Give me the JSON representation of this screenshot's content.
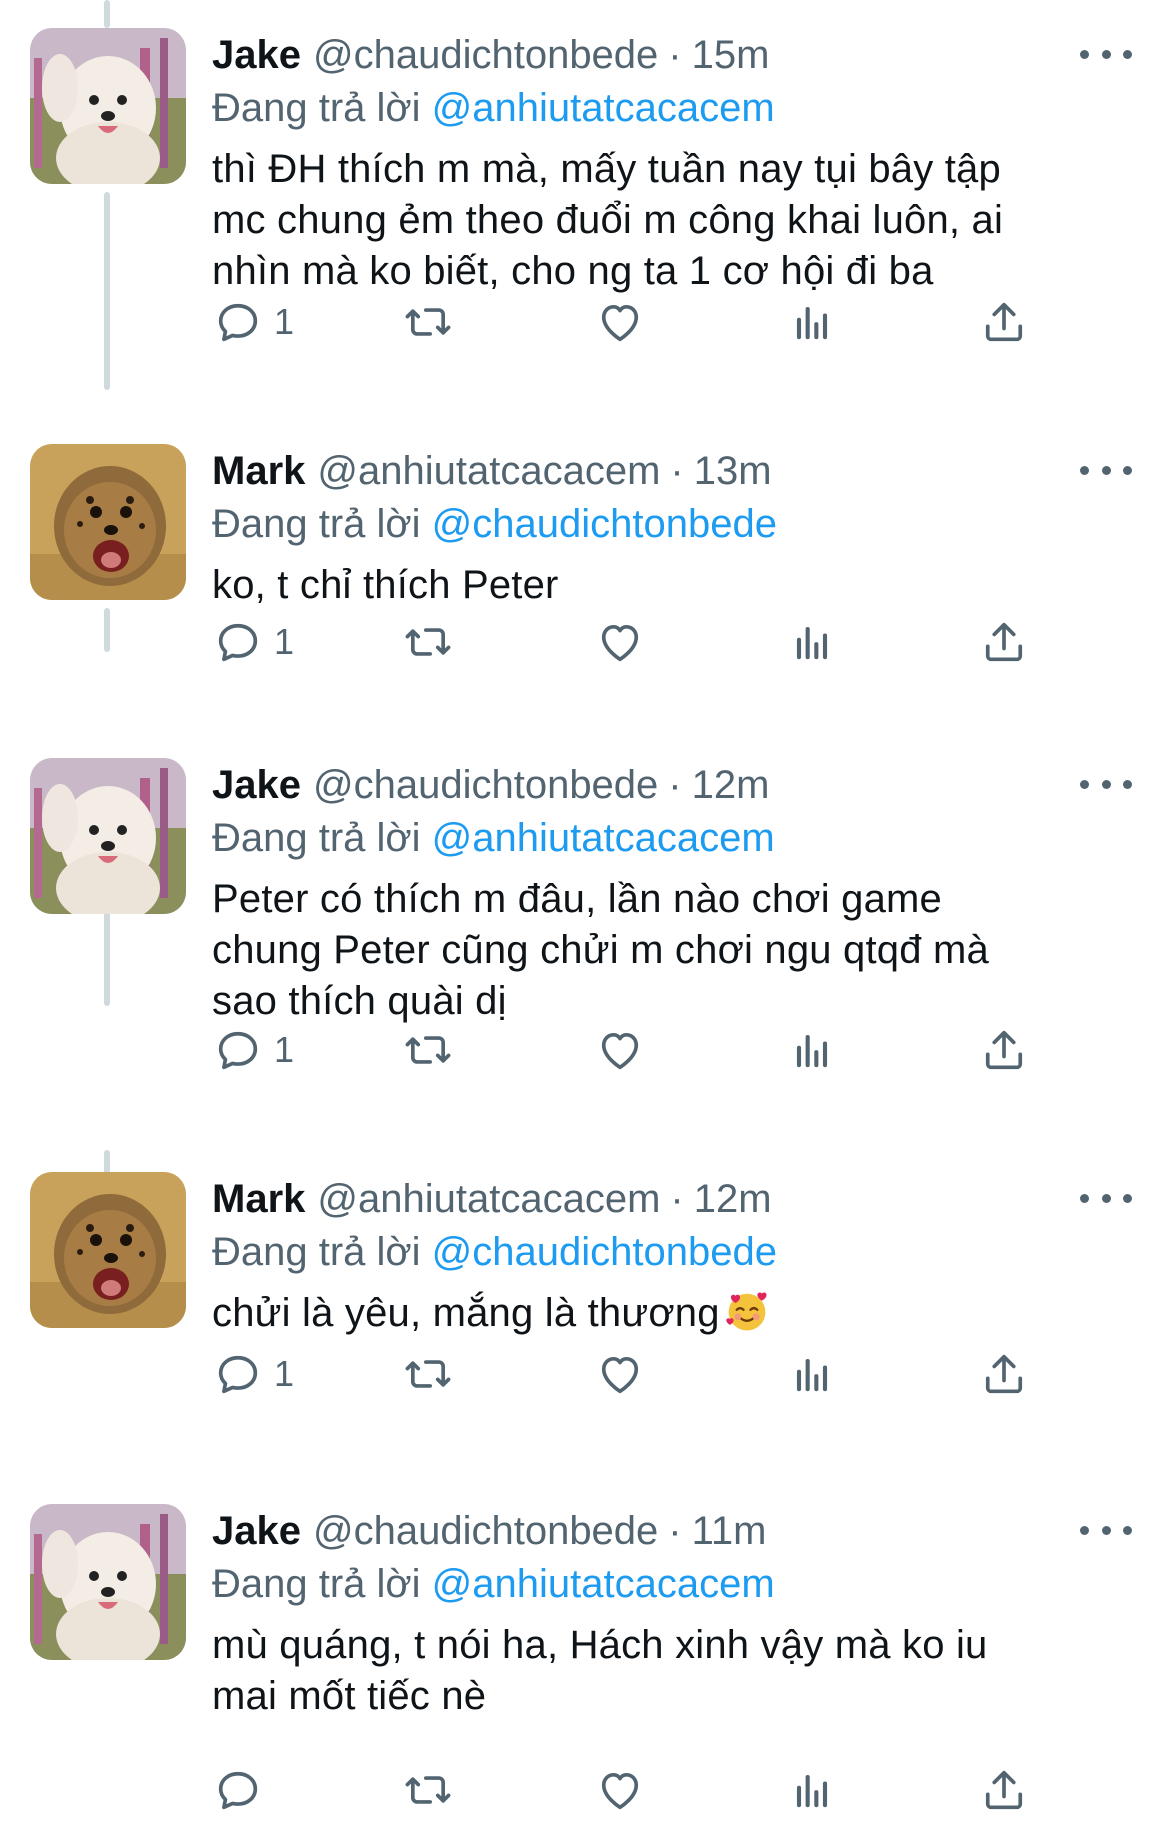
{
  "replying_prefix": "Đang trả lời",
  "colors": {
    "accent": "#1d9bf0",
    "muted": "#536471",
    "text": "#0f1419"
  },
  "icons": {
    "reply": "reply-icon",
    "retweet": "retweet-icon",
    "like": "heart-icon",
    "views": "views-icon",
    "share": "share-icon",
    "more": "more-icon"
  },
  "tweets": [
    {
      "name": "Jake",
      "handle": "@chaudichtonbede",
      "sep": "·",
      "time": "15m",
      "mention": "@anhiutatcacacem",
      "lines": [
        "thì ĐH thích m mà, mấy tuần nay tụi bây tập",
        "mc chung ẻm theo đuổi m công khai luôn, ai",
        "nhìn mà ko biết, cho ng ta 1 cơ hội đi ba"
      ],
      "reply_count": "1",
      "avatar": "samoyed-dog"
    },
    {
      "name": "Mark",
      "handle": "@anhiutatcacacem",
      "sep": "·",
      "time": "13m",
      "mention": "@chaudichtonbede",
      "lines": [
        "ko, t chỉ thích Peter"
      ],
      "reply_count": "1",
      "avatar": "cheetah-cub"
    },
    {
      "name": "Jake",
      "handle": "@chaudichtonbede",
      "sep": "·",
      "time": "12m",
      "mention": "@anhiutatcacacem",
      "lines": [
        "Peter có thích m đâu, lần nào chơi game",
        "chung Peter cũng chửi m chơi ngu qtqđ mà",
        "sao thích quài dị"
      ],
      "reply_count": "1",
      "avatar": "samoyed-dog"
    },
    {
      "name": "Mark",
      "handle": "@anhiutatcacacem",
      "sep": "·",
      "time": "12m",
      "mention": "@chaudichtonbede",
      "lines": [
        "chửi là yêu, mắng là thương"
      ],
      "emoji": "smiling-face-with-hearts",
      "reply_count": "1",
      "avatar": "cheetah-cub"
    },
    {
      "name": "Jake",
      "handle": "@chaudichtonbede",
      "sep": "·",
      "time": "11m",
      "mention": "@anhiutatcacacem",
      "lines": [
        "mù quáng, t nói ha, Hách xinh vậy mà ko iu",
        "mai mốt tiếc nè"
      ],
      "reply_count": "",
      "avatar": "samoyed-dog"
    }
  ]
}
